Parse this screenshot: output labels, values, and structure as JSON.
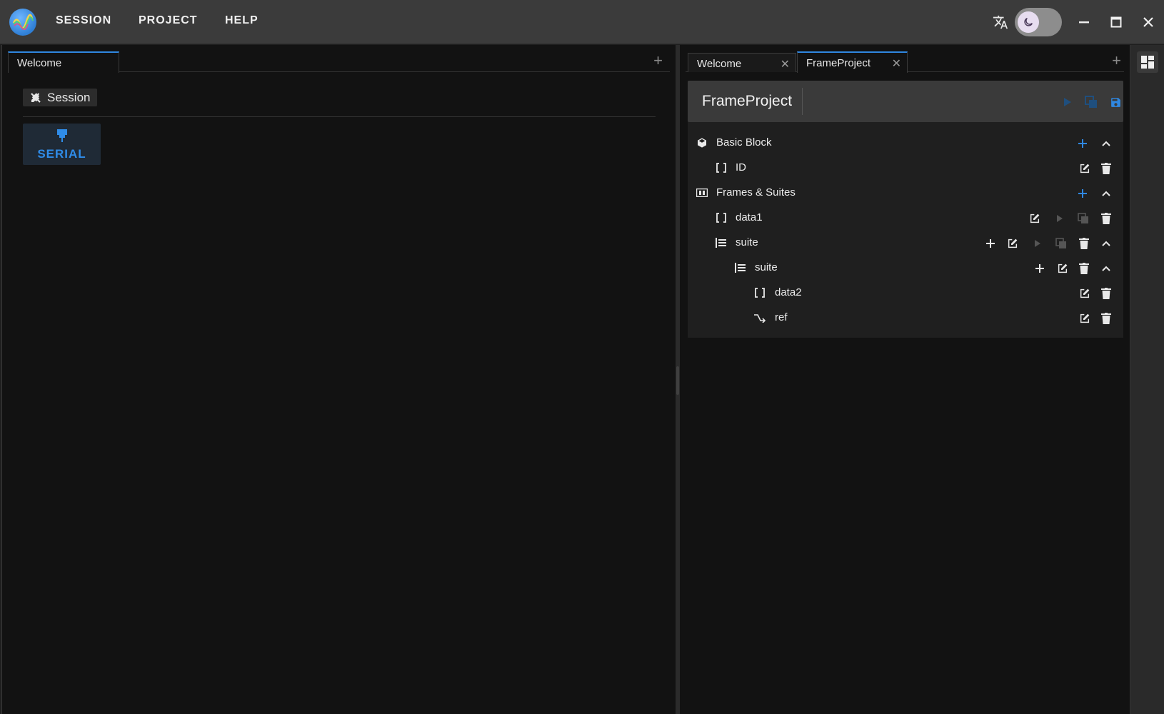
{
  "menu": {
    "session": "SESSION",
    "project": "PROJECT",
    "help": "HELP"
  },
  "titlebar_icons": [
    "translate-icon",
    "moon-icon",
    "minimize-icon",
    "maximize-icon",
    "close-icon"
  ],
  "left_panel": {
    "tabs": [
      {
        "label": "Welcome"
      }
    ],
    "session_label": "Session",
    "serial_label": "SERIAL"
  },
  "right_panel": {
    "tabs": [
      {
        "label": "Welcome"
      },
      {
        "label": "FrameProject"
      }
    ],
    "project_title": "FrameProject",
    "sections": [
      {
        "label": "Basic Block",
        "icon": "cube-icon"
      },
      {
        "label": "Frames & Suites",
        "icon": "frames-icon"
      }
    ],
    "items": [
      {
        "label": "ID",
        "icon": "brackets-icon"
      },
      {
        "label": "data1",
        "icon": "brackets-icon"
      },
      {
        "label": "suite",
        "icon": "suite-icon"
      },
      {
        "label": "suite",
        "icon": "suite-icon"
      },
      {
        "label": "data2",
        "icon": "brackets-icon"
      },
      {
        "label": "ref",
        "icon": "reference-icon"
      }
    ]
  },
  "colors": {
    "accent": "#2f87e0",
    "titlebar": "#3b3b3b",
    "panel": "#121212",
    "card": "#1f1f1f"
  }
}
